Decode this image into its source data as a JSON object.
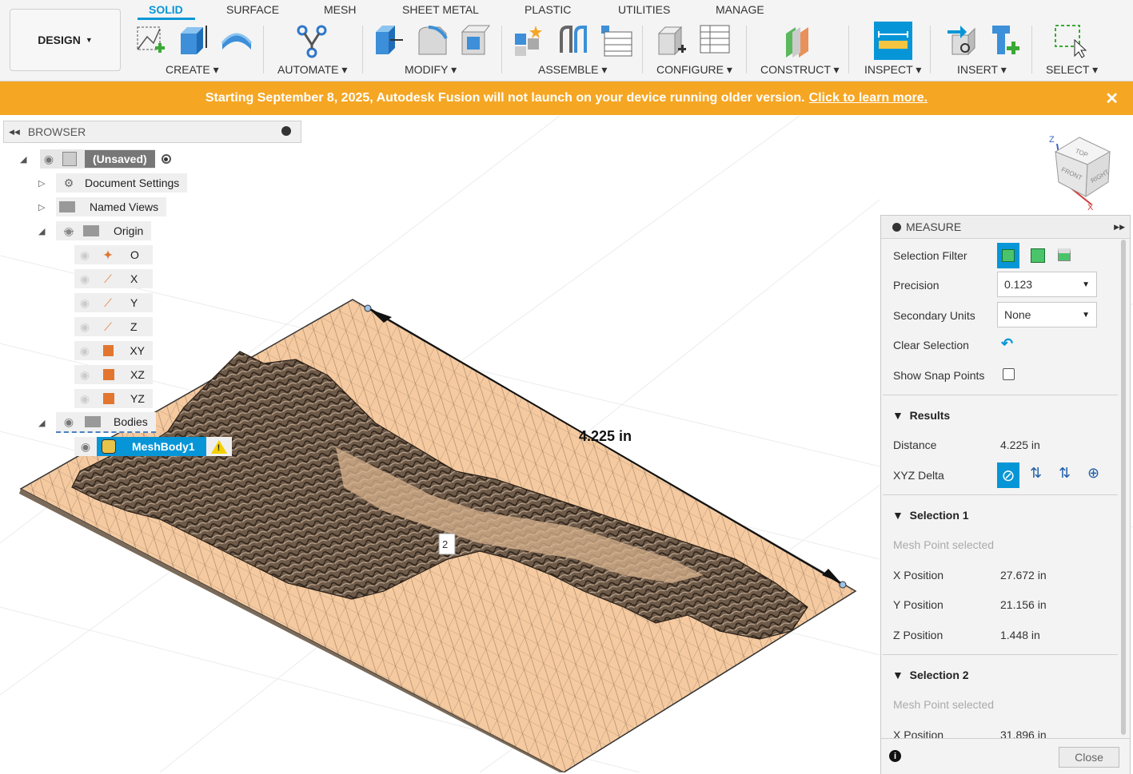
{
  "toolbar": {
    "workspace": "DESIGN",
    "tabs": [
      "SOLID",
      "SURFACE",
      "MESH",
      "SHEET METAL",
      "PLASTIC",
      "UTILITIES",
      "MANAGE"
    ],
    "groups": [
      "CREATE",
      "AUTOMATE",
      "MODIFY",
      "ASSEMBLE",
      "CONFIGURE",
      "CONSTRUCT",
      "INSPECT",
      "INSERT",
      "SELECT"
    ],
    "accent": "#0696d7"
  },
  "banner": {
    "text": "Starting September 8, 2025, Autodesk Fusion will not launch on your device running older version.",
    "link": "Click to learn more.",
    "close": "✕",
    "color": "#f5a623"
  },
  "browser": {
    "title": "BROWSER",
    "root": "(Unsaved)",
    "document_settings": "Document Settings",
    "named_views": "Named Views",
    "origin": "Origin",
    "origin_items": [
      "O",
      "X",
      "Y",
      "Z",
      "XY",
      "XZ",
      "YZ"
    ],
    "bodies": "Bodies",
    "body": "MeshBody1"
  },
  "viewport": {
    "dimension_label": "4.225 in",
    "point_label": "2",
    "viewcube": {
      "top": "TOP",
      "front": "FRONT",
      "right": "RIGHT",
      "z": "Z",
      "x": "X"
    }
  },
  "measure": {
    "title": "MEASURE",
    "selection_filter_label": "Selection Filter",
    "precision_label": "Precision",
    "precision_value": "0.123",
    "secondary_units_label": "Secondary Units",
    "secondary_units_value": "None",
    "clear_selection_label": "Clear Selection",
    "show_snap_points_label": "Show Snap Points",
    "results": "Results",
    "distance_label": "Distance",
    "distance_value": "4.225 in",
    "xyz_delta_label": "XYZ Delta",
    "selection1": "Selection 1",
    "selection1_status": "Mesh Point selected",
    "x_label": "X Position",
    "x1": "27.672 in",
    "y_label": "Y Position",
    "y1": "21.156 in",
    "z_label": "Z Position",
    "z1": "1.448 in",
    "selection2": "Selection 2",
    "selection2_status": "Mesh Point selected",
    "x2": "31.896 in",
    "close": "Close"
  }
}
